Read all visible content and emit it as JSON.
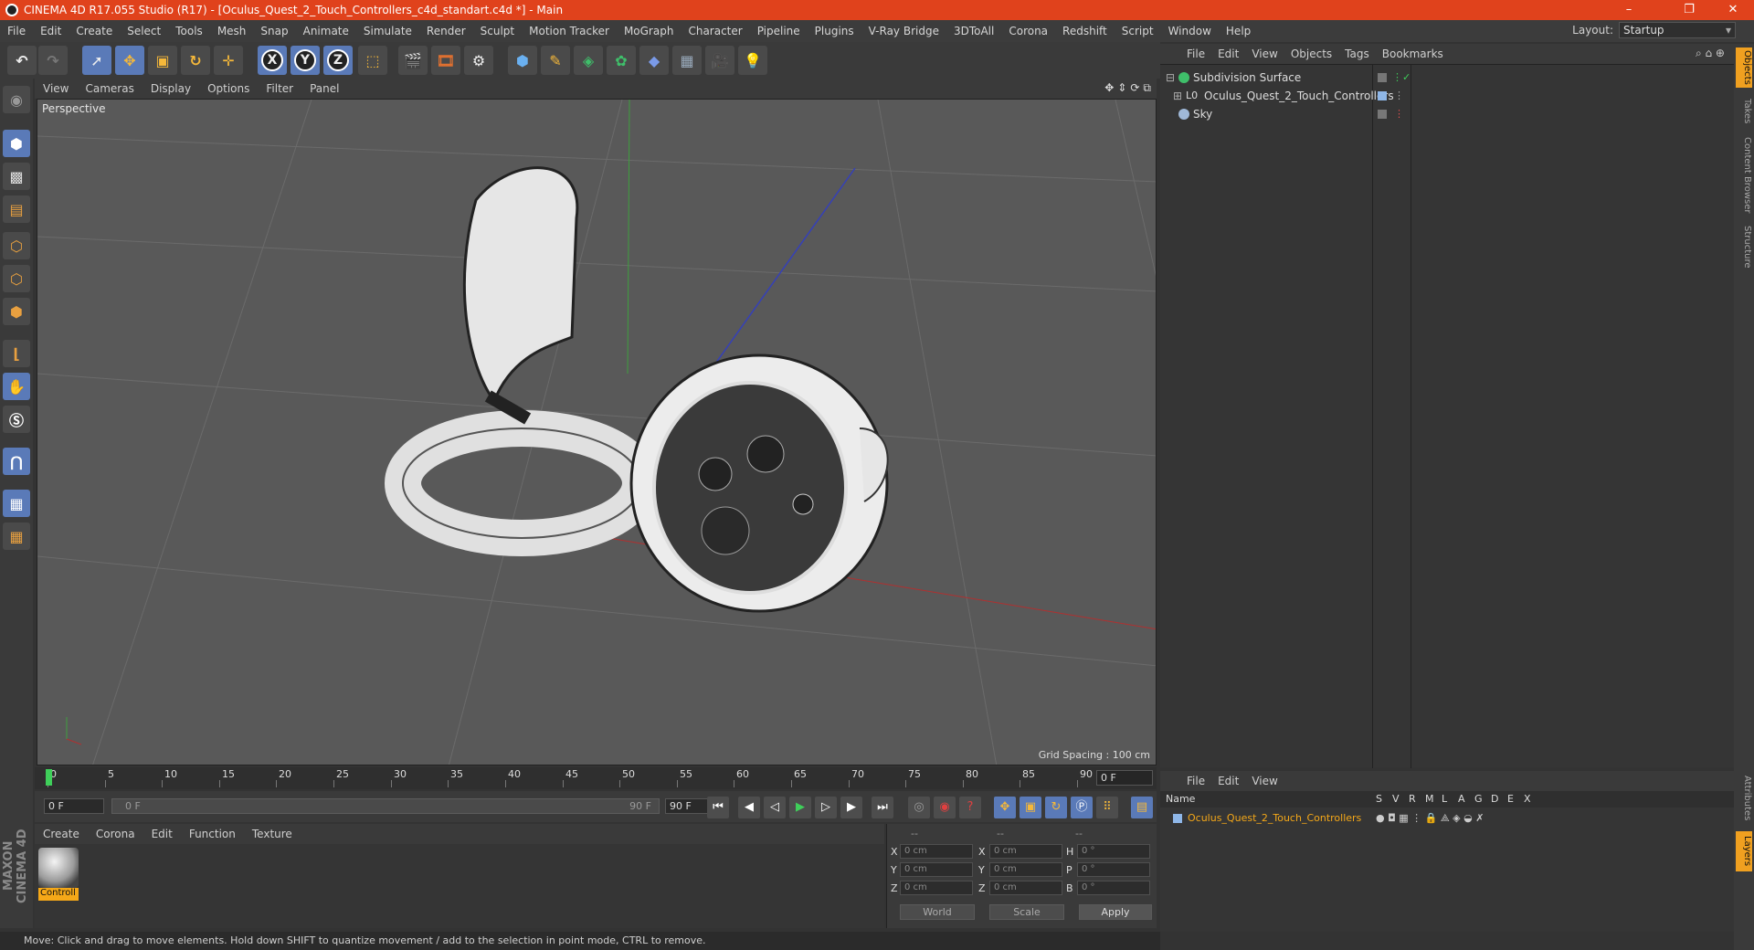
{
  "window": {
    "title": "CINEMA 4D R17.055 Studio (R17) - [Oculus_Quest_2_Touch_Controllers_c4d_standart.c4d *] - Main",
    "controls": [
      "–",
      "❐",
      "✕"
    ]
  },
  "menubar": {
    "items": [
      "File",
      "Edit",
      "Create",
      "Select",
      "Tools",
      "Mesh",
      "Snap",
      "Animate",
      "Simulate",
      "Render",
      "Sculpt",
      "Motion Tracker",
      "MoGraph",
      "Character",
      "Pipeline",
      "Plugins",
      "V-Ray Bridge",
      "3DToAll",
      "Corona",
      "Redshift",
      "Script",
      "Window",
      "Help"
    ],
    "layout_label": "Layout:",
    "layout_value": "Startup"
  },
  "toolbar": {
    "axis_x": "X",
    "axis_y": "Y",
    "axis_z": "Z"
  },
  "viewport": {
    "menu": [
      "View",
      "Cameras",
      "Display",
      "Options",
      "Filter",
      "Panel"
    ],
    "label": "Perspective",
    "grid_spacing": "Grid Spacing : 100 cm"
  },
  "timeline": {
    "ticks": [
      "0",
      "5",
      "10",
      "15",
      "20",
      "25",
      "30",
      "35",
      "40",
      "45",
      "50",
      "55",
      "60",
      "65",
      "70",
      "75",
      "80",
      "85",
      "90"
    ],
    "current_frame": "0 F",
    "start_field": "0 F",
    "range_start": "0 F",
    "range_end": "90 F",
    "end_field": "90 F"
  },
  "material_manager": {
    "menu": [
      "Create",
      "Corona",
      "Edit",
      "Function",
      "Texture"
    ],
    "materials": [
      {
        "name": "Controll"
      }
    ]
  },
  "coordinates": {
    "header": [
      "--",
      "--",
      "--"
    ],
    "rows": [
      {
        "axis": "X",
        "pos": "0 cm",
        "axis2": "X",
        "size": "0 cm",
        "rot_axis": "H",
        "rot": "0 °"
      },
      {
        "axis": "Y",
        "pos": "0 cm",
        "axis2": "Y",
        "size": "0 cm",
        "rot_axis": "P",
        "rot": "0 °"
      },
      {
        "axis": "Z",
        "pos": "0 cm",
        "axis2": "Z",
        "size": "0 cm",
        "rot_axis": "B",
        "rot": "0 °"
      }
    ],
    "space": "World",
    "mode": "Scale",
    "apply": "Apply"
  },
  "statusbar": {
    "text": "Move: Click and drag to move elements. Hold down SHIFT to quantize movement / add to the selection in point mode, CTRL to remove."
  },
  "object_manager": {
    "menu": [
      "File",
      "Edit",
      "View",
      "Objects",
      "Tags",
      "Bookmarks"
    ],
    "objects": [
      {
        "name": "Subdivision Surface",
        "color": "#3fbf6a"
      },
      {
        "name": "Oculus_Quest_2_Touch_Controllers",
        "color": "#8fb7e8"
      },
      {
        "name": "Sky",
        "color": "#9fb8d8"
      }
    ]
  },
  "layer_manager": {
    "menu": [
      "File",
      "Edit",
      "View"
    ],
    "columns": [
      "Name",
      "S",
      "V",
      "R",
      "M",
      "L",
      "A",
      "G",
      "D",
      "E",
      "X"
    ],
    "layers": [
      {
        "name": "Oculus_Quest_2_Touch_Controllers",
        "color": "#f5a818"
      }
    ]
  },
  "side_tabs": [
    "Objects",
    "Takes",
    "Content Browser",
    "Structure"
  ],
  "side_tabs_bottom": [
    "Attributes",
    "Layers"
  ],
  "brand": "MAXON CINEMA 4D",
  "colors": {
    "titlebar": "#e0421c",
    "accent": "#f5a818",
    "selection": "#5a7ab8"
  }
}
